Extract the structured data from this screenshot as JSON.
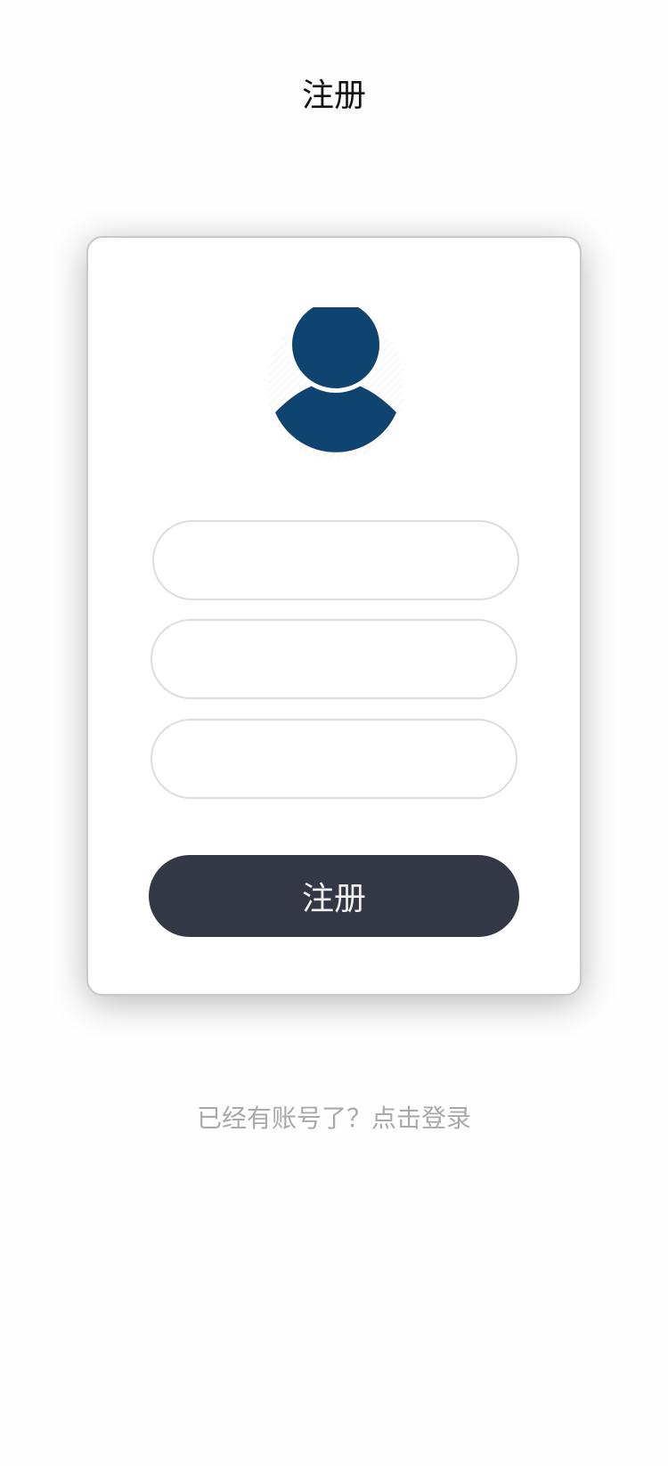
{
  "header": {
    "title": "注册"
  },
  "form": {
    "avatar_icon": "user-avatar-icon",
    "avatar_color": "#0f4470",
    "fields": [
      {
        "value": "",
        "placeholder": ""
      },
      {
        "value": "",
        "placeholder": ""
      },
      {
        "value": "",
        "placeholder": ""
      }
    ],
    "submit_label": "注册",
    "submit_color": "#343744"
  },
  "footer": {
    "login_link": "已经有账号了？点击登录"
  }
}
